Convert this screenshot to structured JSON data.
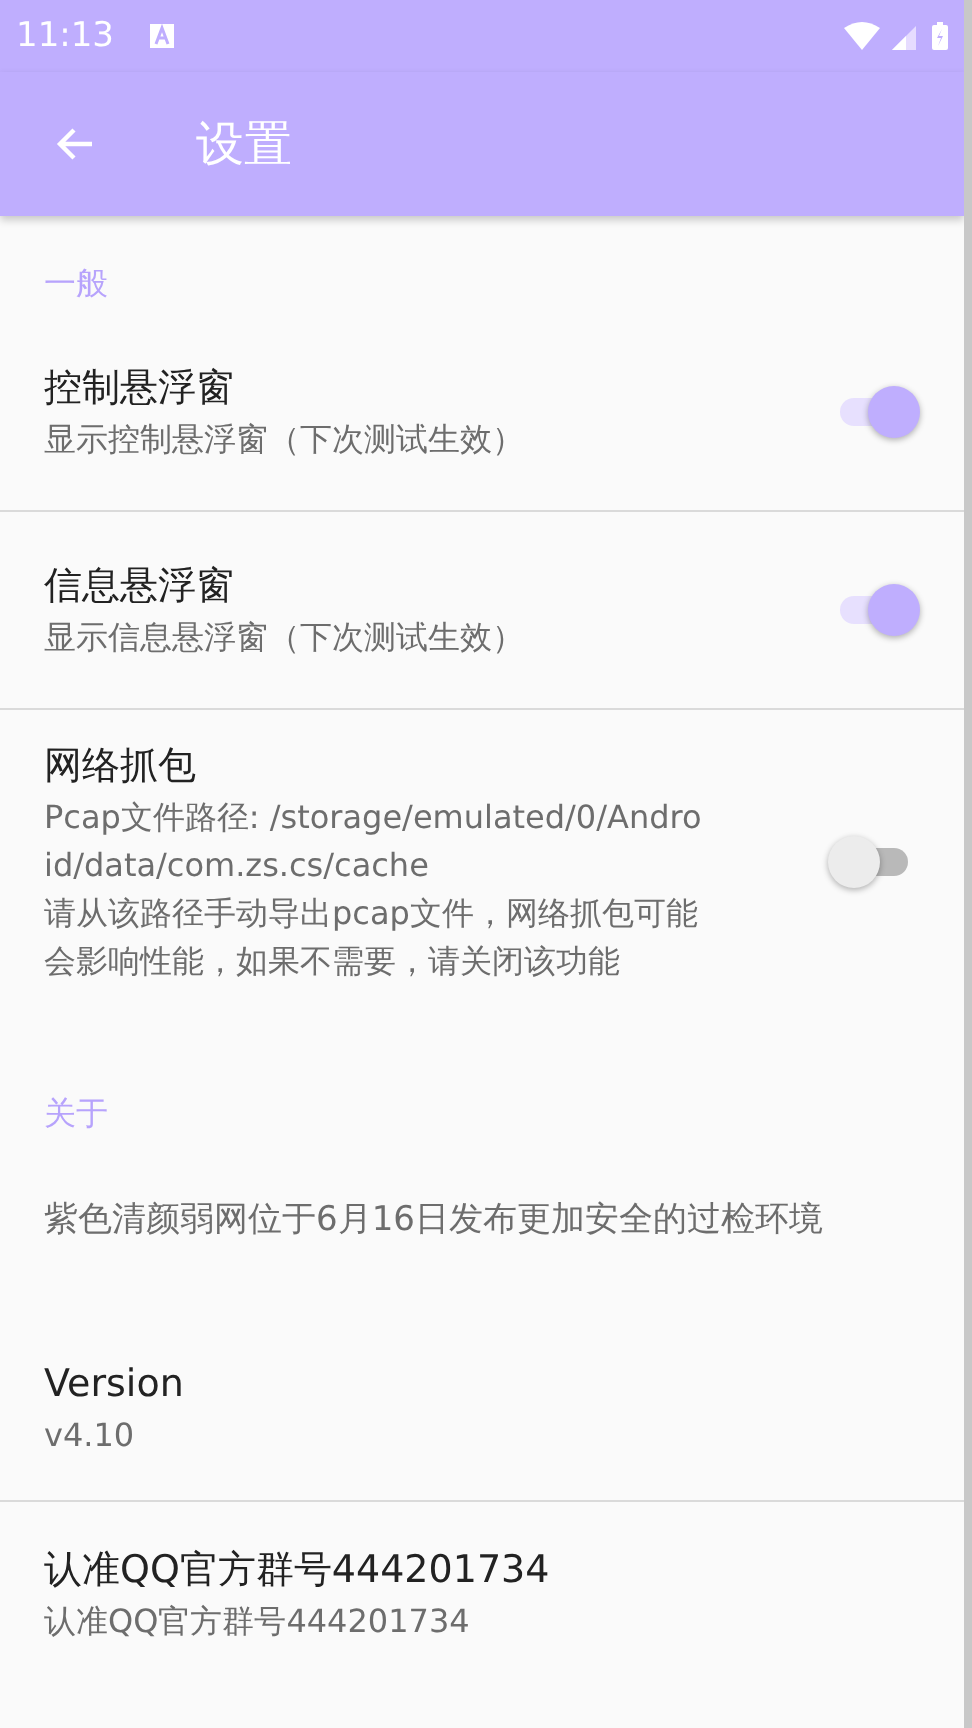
{
  "status_bar": {
    "time": "11:13"
  },
  "toolbar": {
    "title": "设置"
  },
  "sections": [
    {
      "header": "一般",
      "items": [
        {
          "kind": "switch",
          "title": "控制悬浮窗",
          "summary": "显示控制悬浮窗（下次测试生效）",
          "on": true,
          "divider": true
        },
        {
          "kind": "switch",
          "title": "信息悬浮窗",
          "summary": "显示信息悬浮窗（下次测试生效）",
          "on": true,
          "divider": true
        },
        {
          "kind": "switch",
          "title": "网络抓包",
          "summary": "Pcap文件路径: /storage/emulated/0/Android/data/com.zs.cs/cache\n请从该路径手动导出pcap文件，网络抓包可能会影响性能，如果不需要，请关闭该功能",
          "on": false,
          "divider": false
        }
      ]
    },
    {
      "header": "关于",
      "items": [
        {
          "kind": "note",
          "summary": "紫色清颜弱网位于6月16日发布更加安全的过检环境",
          "divider": false
        },
        {
          "kind": "info",
          "title": "Version",
          "summary": "v4.10",
          "divider": true
        },
        {
          "kind": "info",
          "title": "认准QQ官方群号444201734",
          "summary": "认准QQ官方群号444201734",
          "divider": false
        }
      ]
    }
  ]
}
